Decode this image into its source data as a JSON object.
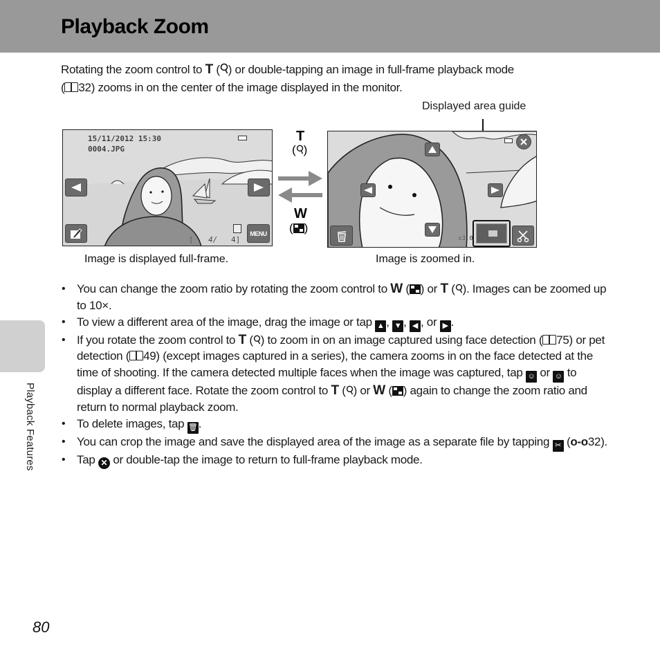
{
  "header": {
    "title": "Playback Zoom",
    "background": "#999999"
  },
  "intro": {
    "part1": "Rotating the zoom control to ",
    "t_label": "T",
    "part2": " (",
    "part3": ") or double-tapping an image in full-frame playback mode",
    "part4": "(",
    "ref": "32",
    "part5": ") zooms in on the center of the image displayed in the monitor."
  },
  "figure": {
    "guide_caption": "Displayed area guide",
    "full_frame": {
      "date_time": "15/11/2012  15:30",
      "filename": "0004.JPG",
      "counter_open": "[",
      "counter_current": "4/",
      "counter_total": "4]",
      "menu_label": "MENU",
      "caption": "Image is displayed full-frame."
    },
    "zoomed": {
      "zoom_readout": "x3.0",
      "caption": "Image is zoomed in."
    },
    "t_label": "T",
    "w_label": "W",
    "t_icon": "magnifier-icon",
    "w_icon": "thumbnail-grid-icon"
  },
  "bullets": [
    {
      "a": "You can change the zoom ratio by rotating the zoom control to ",
      "w": "W",
      "b": " (",
      "c": ") or ",
      "t": "T",
      "d": " (",
      "e": "). Images can be zoomed up to 10×."
    },
    {
      "a": "To view a different area of the image, drag the image or tap ",
      "sep1": ", ",
      "sep2": ", ",
      "sep3": ", or ",
      "end": "."
    },
    {
      "a": "If you rotate the zoom control to ",
      "t": "T",
      "b": " (",
      "c": ") to zoom in on an image captured using face detection (",
      "ref1": "75",
      "d": ") or pet detection (",
      "ref2": "49",
      "e": ") (except images captured in a series), the camera zooms in on the face detected at the time of shooting. If the camera detected multiple faces when the image was captured, tap ",
      "f": " or ",
      "g": " to display a different face. Rotate the zoom control to ",
      "t2": "T",
      "h": " (",
      "i": ") or ",
      "w": "W",
      "j": " (",
      "k": ") again to change the zoom ratio and return to normal playback zoom."
    },
    {
      "a": "To delete images, tap ",
      "end": "."
    },
    {
      "a": "You can crop the image and save the displayed area of the image as a separate file by tapping ",
      "b": " (",
      "ref": "32",
      "end": ")."
    },
    {
      "a": "Tap ",
      "b": " or double-tap the image to return to full-frame playback mode."
    }
  ],
  "side_tab": {
    "label": "Playback Features"
  },
  "page_number": "80"
}
